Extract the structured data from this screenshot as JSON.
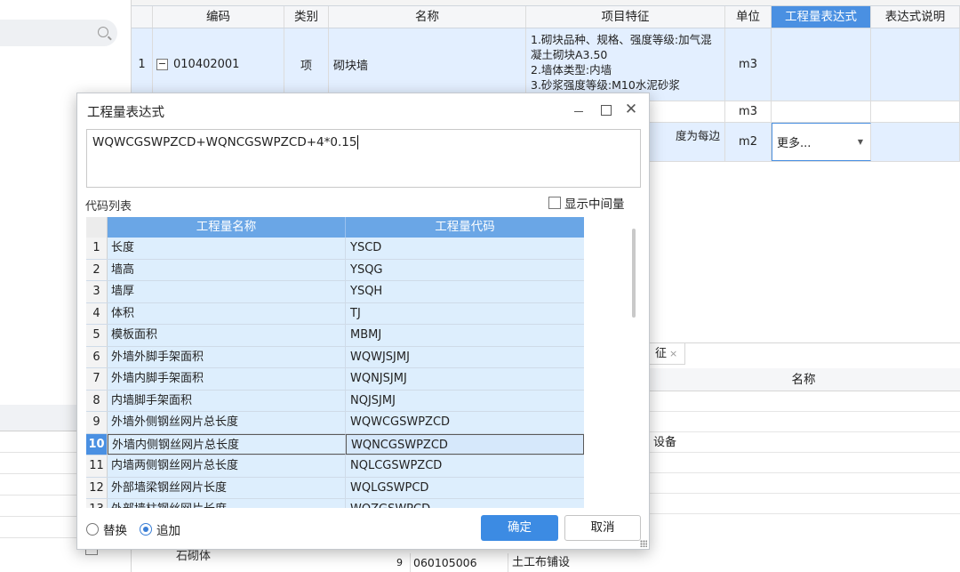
{
  "grid": {
    "headers": [
      "编码",
      "类别",
      "名称",
      "项目特征",
      "单位",
      "工程量表达式",
      "表达式说明"
    ],
    "row1": {
      "index": "1",
      "code": "010402001",
      "type": "项",
      "name": "砌块墙",
      "features": "1.砌块品种、规格、强度等级:加气混凝土砌块A3.50\n2.墙体类型:内墙\n3.砂浆强度等级:M10水泥砂浆",
      "unit": "m3"
    },
    "row2": {
      "unit": "m3"
    },
    "row3": {
      "features_fragment": "度为每边",
      "unit": "m2",
      "expr_dropdown": "更多..."
    }
  },
  "bottom_panel": {
    "tab_label": "征",
    "header": "名称",
    "rows": [
      "",
      "",
      "设备",
      "",
      "",
      ""
    ],
    "last_row": {
      "index": "9",
      "code": "060105006",
      "name": "土工布铺设"
    }
  },
  "background": {
    "left_item": "石砌体"
  },
  "dialog": {
    "title": "工程量表达式",
    "expression": "WQWCGSWPZCD+WQNCGSWPZCD+4*0.15",
    "code_list_label": "代码列表",
    "show_intermediate_label": "显示中间量",
    "table": {
      "headers": {
        "name": "工程量名称",
        "code": "工程量代码"
      },
      "rows": [
        {
          "index": "1",
          "name": "长度",
          "code": "YSCD"
        },
        {
          "index": "2",
          "name": "墙高",
          "code": "YSQG"
        },
        {
          "index": "3",
          "name": "墙厚",
          "code": "YSQH"
        },
        {
          "index": "4",
          "name": "体积",
          "code": "TJ"
        },
        {
          "index": "5",
          "name": "模板面积",
          "code": "MBMJ"
        },
        {
          "index": "6",
          "name": "外墙外脚手架面积",
          "code": "WQWJSJMJ"
        },
        {
          "index": "7",
          "name": "外墙内脚手架面积",
          "code": "WQNJSJMJ"
        },
        {
          "index": "8",
          "name": "内墙脚手架面积",
          "code": "NQJSJMJ"
        },
        {
          "index": "9",
          "name": "外墙外侧钢丝网片总长度",
          "code": "WQWCGSWPZCD"
        },
        {
          "index": "10",
          "name": "外墙内侧钢丝网片总长度",
          "code": "WQNCGSWPZCD"
        },
        {
          "index": "11",
          "name": "内墙两侧钢丝网片总长度",
          "code": "NQLCGSWPZCD"
        },
        {
          "index": "12",
          "name": "外部墙梁钢丝网片长度",
          "code": "WQLGSWPCD"
        },
        {
          "index": "13",
          "name": "外部墙柱钢丝网片长度",
          "code": "WQZGSWPCD"
        }
      ],
      "selected_index": "10"
    },
    "radio_replace": "替换",
    "radio_append": "追加",
    "ok_label": "确定",
    "cancel_label": "取消"
  }
}
